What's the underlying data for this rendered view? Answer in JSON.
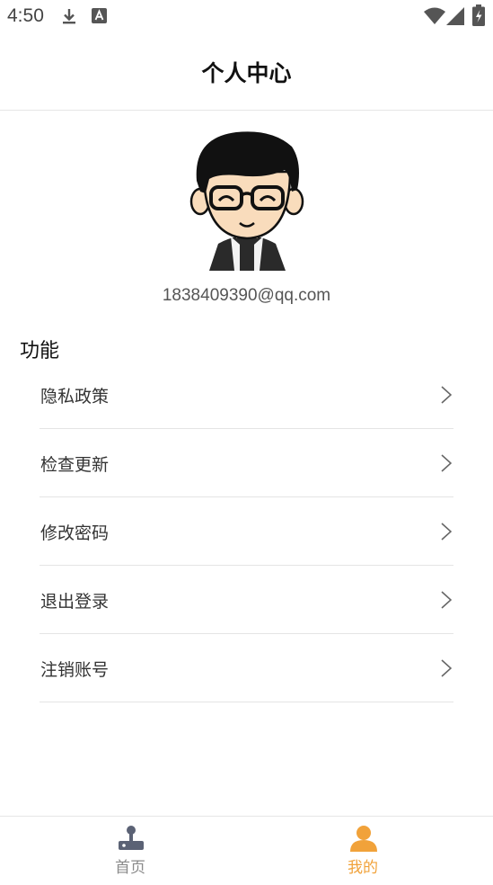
{
  "status_bar": {
    "time": "4:50"
  },
  "header": {
    "title": "个人中心"
  },
  "profile": {
    "email": "1838409390@qq.com"
  },
  "functions": {
    "section_title": "功能",
    "items": [
      {
        "label": "隐私政策"
      },
      {
        "label": "检查更新"
      },
      {
        "label": "修改密码"
      },
      {
        "label": "退出登录"
      },
      {
        "label": "注销账号"
      }
    ]
  },
  "bottom_nav": {
    "tabs": [
      {
        "label": "首页",
        "icon": "joystick-icon",
        "active": false
      },
      {
        "label": "我的",
        "icon": "person-icon",
        "active": true
      }
    ],
    "active_color": "#f1a23a",
    "inactive_color": "#8a8a8a"
  }
}
